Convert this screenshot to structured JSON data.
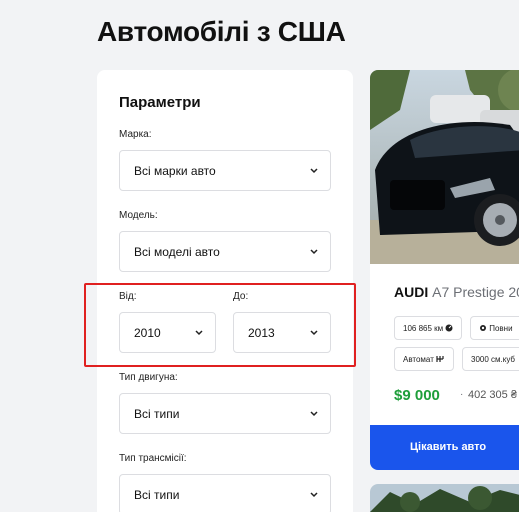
{
  "page": {
    "title": "Автомобілі з США"
  },
  "filters": {
    "title": "Параметри",
    "make": {
      "label": "Марка:",
      "value": "Всі марки авто"
    },
    "model": {
      "label": "Модель:",
      "value": "Всі моделі авто"
    },
    "year_from": {
      "label": "Від:",
      "value": "2010"
    },
    "year_to": {
      "label": "До:",
      "value": "2013"
    },
    "engine": {
      "label": "Тип двигуна:",
      "value": "Всі типи"
    },
    "transmission": {
      "label": "Тип трансмісії:",
      "value": "Всі типи"
    }
  },
  "listing": {
    "make": "AUDI",
    "model": "A7 Prestige 20",
    "chips": {
      "mileage": "106 865 км",
      "damage": "Повни",
      "transmission": "Автомат",
      "engine_volume": "3000 см.куб"
    },
    "price_usd": "$9 000",
    "separator": "·",
    "price_uah": "402 305 ₴",
    "cta": "Цікавить авто"
  },
  "colors": {
    "accent": "#1a55ec",
    "price": "#1e9e3a",
    "highlight": "#e02020"
  }
}
